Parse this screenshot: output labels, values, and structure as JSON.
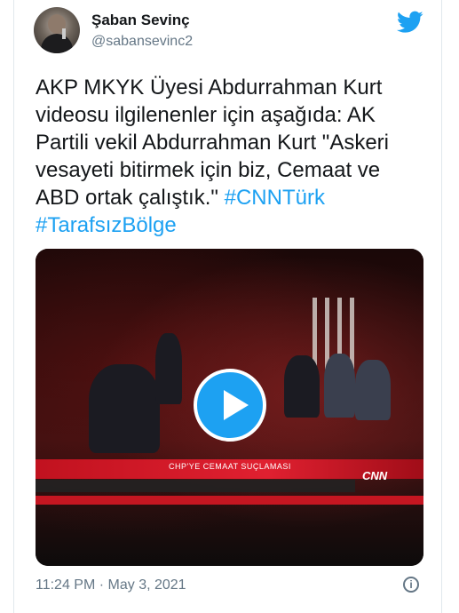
{
  "tweet": {
    "author_name": "Şaban Sevinç",
    "author_handle": "@sabansevinc2",
    "text_plain": "AKP MKYK Üyesi Abdurrahman Kurt videosu ilgilenenler için aşağıda: AK Partili vekil Abdurrahman Kurt \"Askeri vesayeti bitirmek için biz, Cemaat ve ABD ortak çalıştık.\"",
    "hashtags": [
      "#CNNTürk",
      "#TarafsızBölge"
    ],
    "timestamp": "11:24 PM · May 3, 2021"
  },
  "video": {
    "lower_third": "CHP'YE CEMAAT SUÇLAMASI",
    "channel": "CNN"
  },
  "icons": {
    "brand": "twitter-bird-icon",
    "play": "play-icon",
    "info": "info-icon"
  },
  "colors": {
    "accent": "#1da1f2",
    "text": "#14171a",
    "secondary": "#657786"
  }
}
